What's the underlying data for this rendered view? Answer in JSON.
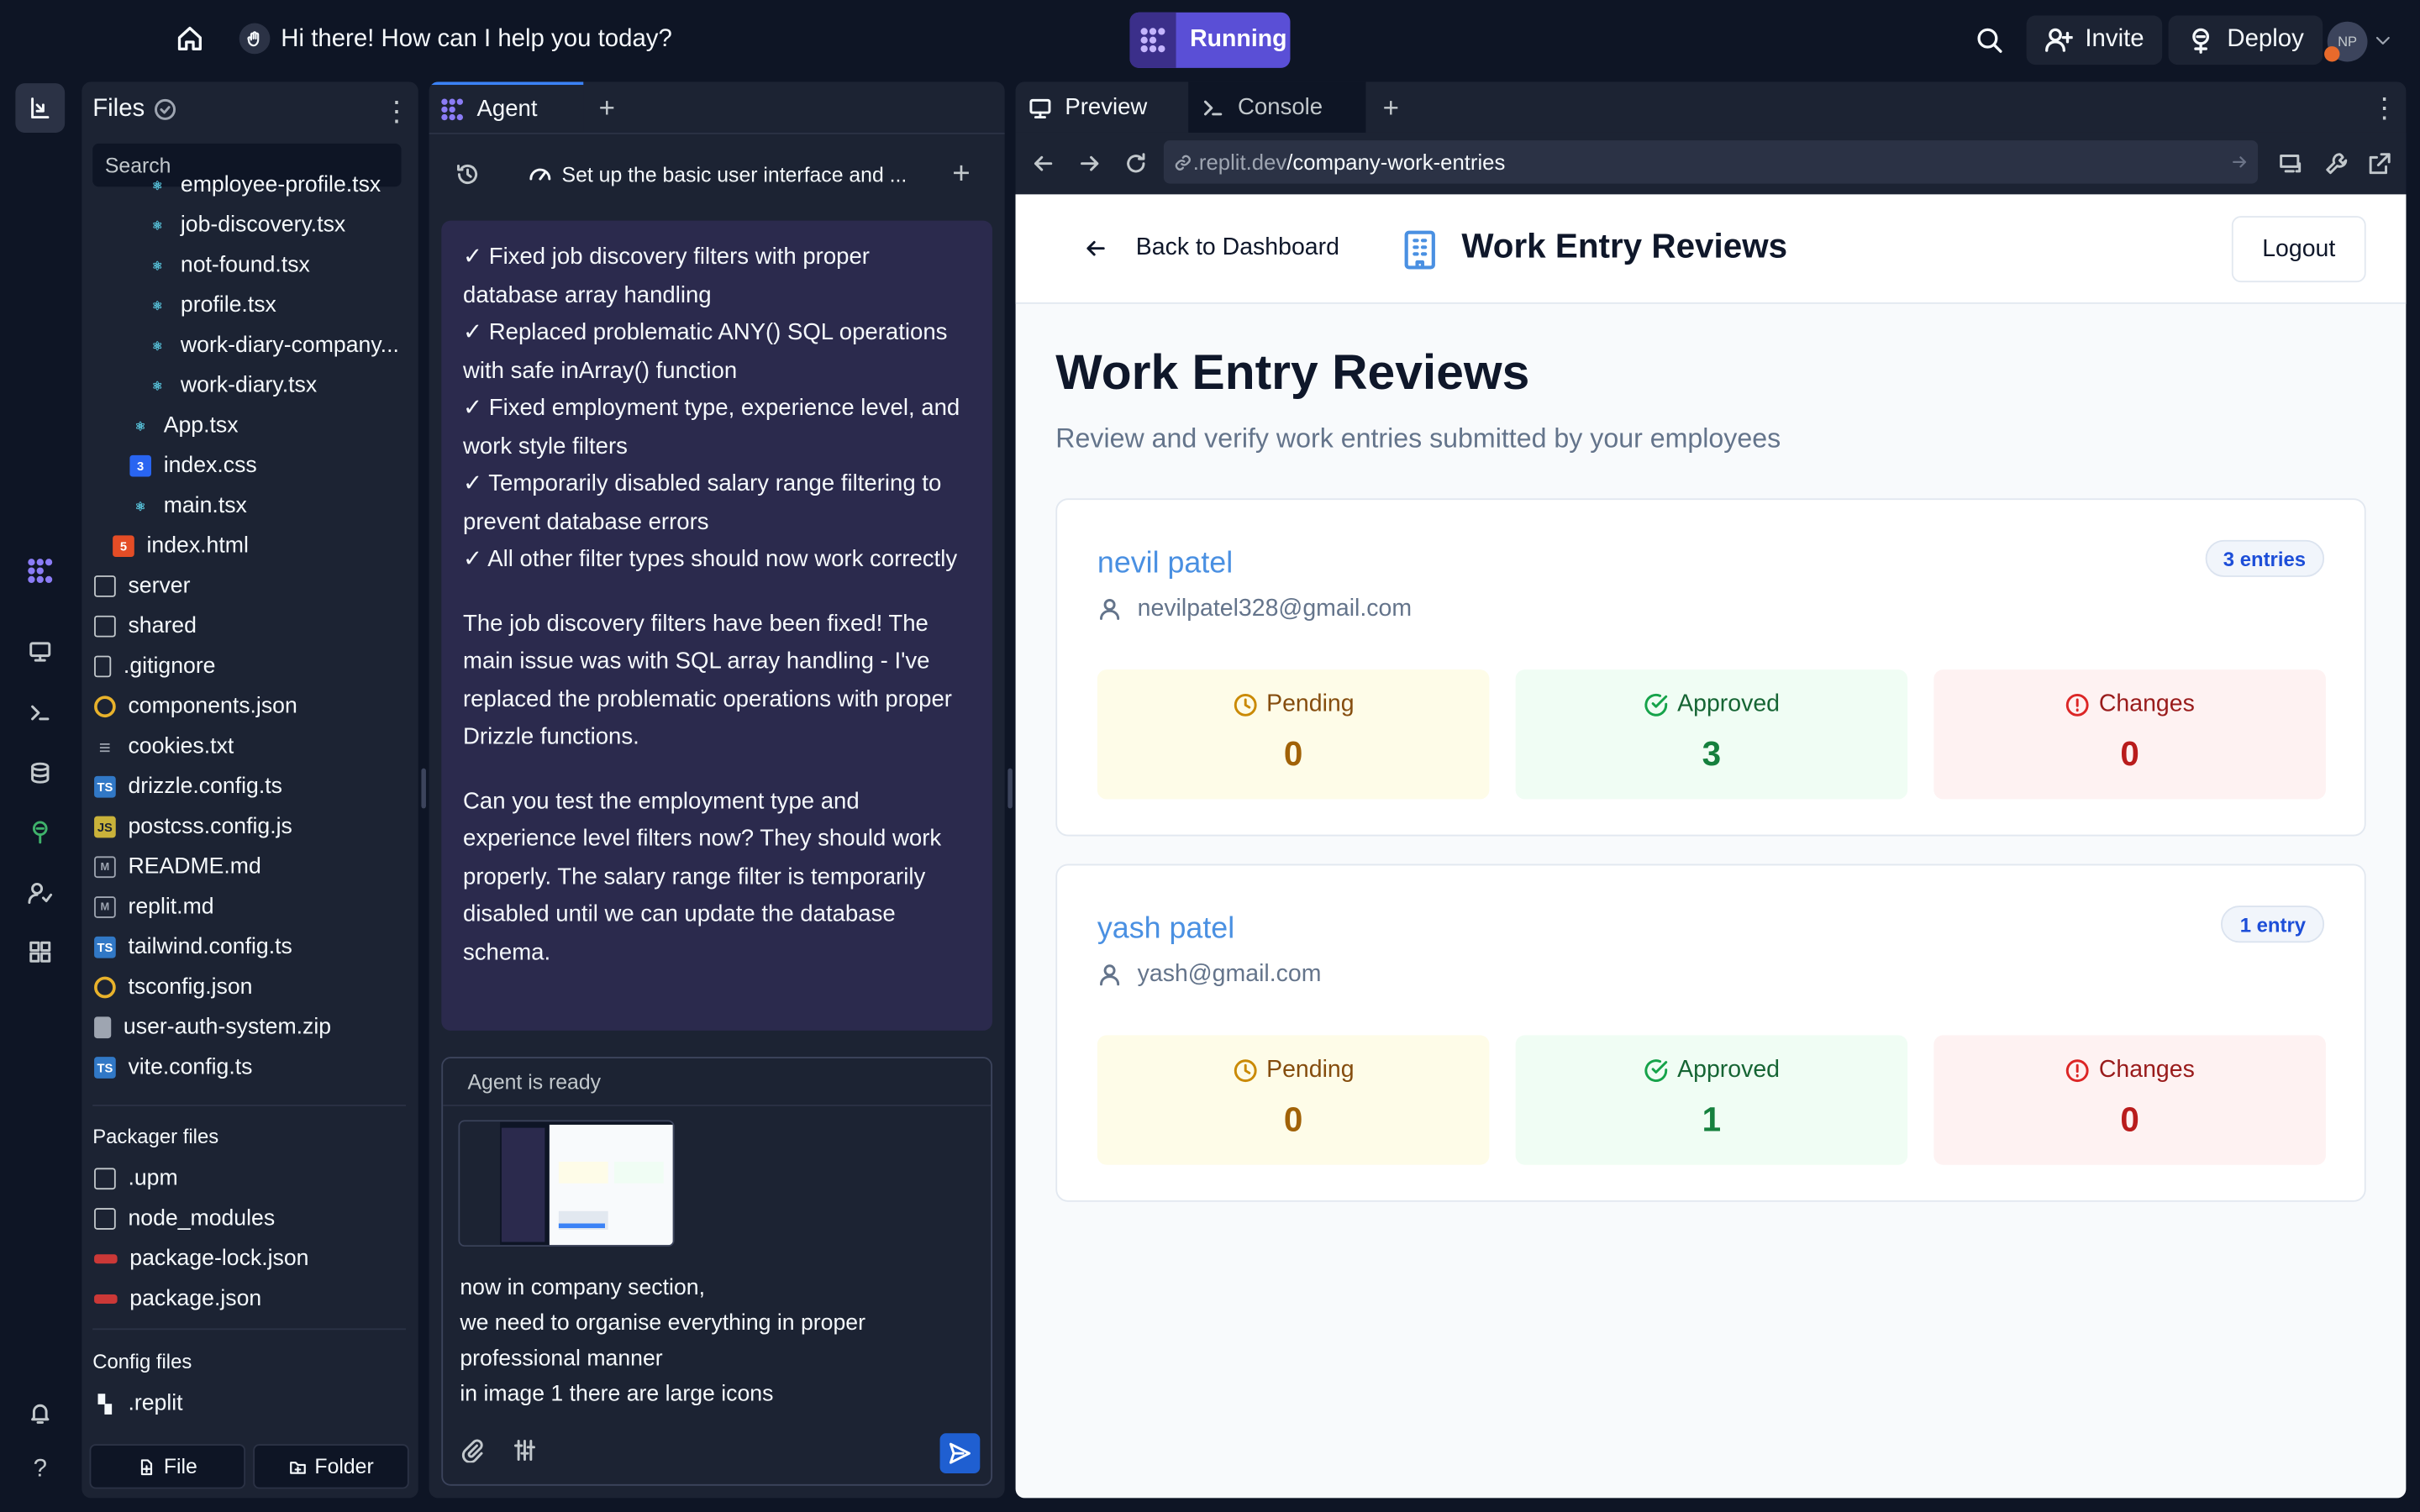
{
  "topbar": {
    "chat_title": "Hi there! How can I help you today?",
    "run_label": "Running",
    "invite_label": "Invite",
    "deploy_label": "Deploy",
    "avatar_initials": "NP"
  },
  "files": {
    "title": "Files",
    "search_placeholder": "Search",
    "items": [
      {
        "name": "employee-profile.tsx",
        "icon": "react-icon"
      },
      {
        "name": "job-discovery.tsx",
        "icon": "react-icon"
      },
      {
        "name": "not-found.tsx",
        "icon": "react-icon"
      },
      {
        "name": "profile.tsx",
        "icon": "react-icon"
      },
      {
        "name": "work-diary-company...",
        "icon": "react-icon"
      },
      {
        "name": "work-diary.tsx",
        "icon": "react-icon"
      },
      {
        "name": "App.tsx",
        "icon": "react-icon"
      },
      {
        "name": "index.css",
        "icon": "css-icon"
      },
      {
        "name": "main.tsx",
        "icon": "react-icon"
      },
      {
        "name": "index.html",
        "icon": "html-icon"
      },
      {
        "name": "server",
        "icon": "folder-icon"
      },
      {
        "name": "shared",
        "icon": "folder-icon"
      },
      {
        "name": ".gitignore",
        "icon": "file-icon"
      },
      {
        "name": "components.json",
        "icon": "json-icon"
      },
      {
        "name": "cookies.txt",
        "icon": "text-icon"
      },
      {
        "name": "drizzle.config.ts",
        "icon": "ts-icon"
      },
      {
        "name": "postcss.config.js",
        "icon": "js-icon"
      },
      {
        "name": "README.md",
        "icon": "markdown-icon"
      },
      {
        "name": "replit.md",
        "icon": "markdown-icon"
      },
      {
        "name": "tailwind.config.ts",
        "icon": "ts-icon"
      },
      {
        "name": "tsconfig.json",
        "icon": "json-icon"
      },
      {
        "name": "user-auth-system.zip",
        "icon": "zip-icon"
      },
      {
        "name": "vite.config.ts",
        "icon": "ts-icon"
      }
    ],
    "packager_title": "Packager files",
    "packager_items": [
      {
        "name": ".upm",
        "icon": "folder-icon"
      },
      {
        "name": "node_modules",
        "icon": "folder-icon"
      },
      {
        "name": "package-lock.json",
        "icon": "npm-icon"
      },
      {
        "name": "package.json",
        "icon": "npm-icon"
      }
    ],
    "config_title": "Config files",
    "config_items": [
      {
        "name": ".replit",
        "icon": "replit-icon"
      }
    ],
    "new_file_label": "File",
    "new_folder_label": "Folder"
  },
  "agent": {
    "tab_label": "Agent",
    "thread_title": "Set up the basic user interface and ...",
    "checklist": [
      "✓ Fixed job discovery filters with proper database array handling",
      "✓ Replaced problematic ANY() SQL operations with safe inArray() function",
      "✓ Fixed employment type, experience level, and work style filters",
      "✓ Temporarily disabled salary range filtering to prevent database errors",
      "✓ All other filter types should now work correctly"
    ],
    "para1": "The job discovery filters have been fixed! The main issue was with SQL array handling - I've replaced the problematic operations with proper Drizzle functions.",
    "para2": "Can you test the employment type and experience level filters now? They should work properly. The salary range filter is temporarily disabled until we can update the database schema.",
    "status": "Agent is ready",
    "input_lines": [
      "now in company section,",
      "we need to organise everything in proper professional manner",
      "in image 1 there are large icons"
    ]
  },
  "preview": {
    "tab_preview": "Preview",
    "tab_console": "Console",
    "url_host": ".replit.dev",
    "url_path": "/company-work-entries",
    "back_label": "Back to Dashboard",
    "header_title": "Work Entry Reviews",
    "logout_label": "Logout",
    "page_title": "Work Entry Reviews",
    "page_subtitle": "Review and verify work entries submitted by your employees",
    "employees": [
      {
        "name": "nevil patel",
        "email": "nevilpatel328@gmail.com",
        "badge": "3 entries",
        "pending": "0",
        "approved": "3",
        "changes": "0"
      },
      {
        "name": "yash patel",
        "email": "yash@gmail.com",
        "badge": "1 entry",
        "pending": "0",
        "approved": "1",
        "changes": "0"
      }
    ],
    "labels": {
      "pending": "Pending",
      "approved": "Approved",
      "changes": "Changes"
    }
  },
  "colors": {
    "accent": "#5a4fd6",
    "link": "#4a90e2",
    "pending_bg": "#fefce8",
    "approved_bg": "#f0fdf4",
    "changes_bg": "#fef2f2"
  }
}
